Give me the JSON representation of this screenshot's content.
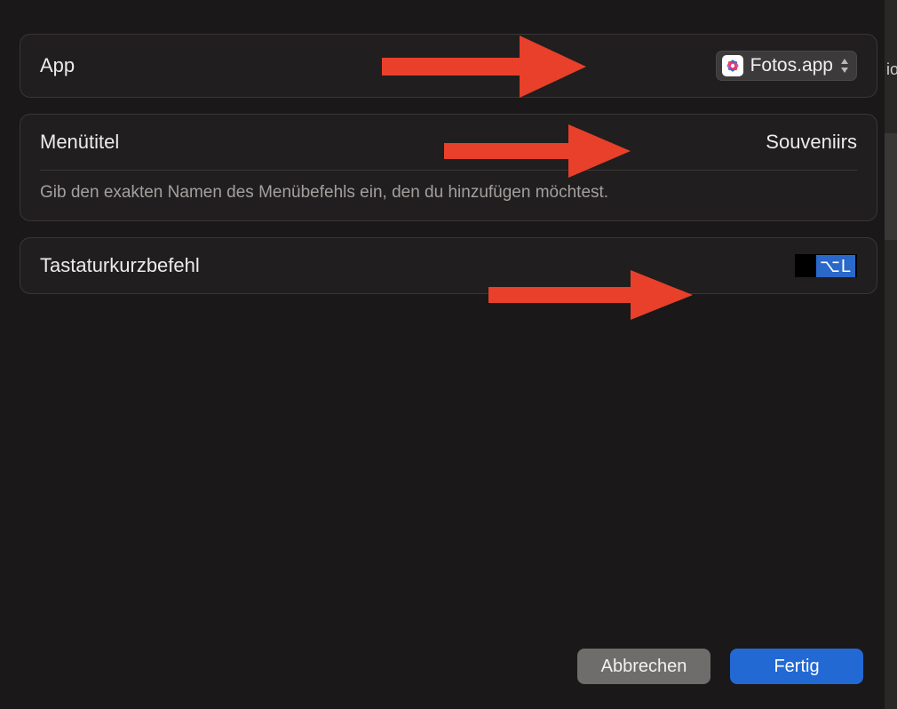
{
  "appRow": {
    "label": "App",
    "selectedAppName": "Fotos.app"
  },
  "menuTitleRow": {
    "label": "Menütitel",
    "value": "Souveniirs",
    "helperText": "Gib den exakten Namen des Menübefehls ein, den du hinzufügen möchtest."
  },
  "shortcutRow": {
    "label": "Tastaturkurzbefehl",
    "value": "⌥L"
  },
  "footer": {
    "cancel": "Abbrechen",
    "done": "Fertig"
  },
  "bgEdge": {
    "partialText": "io"
  }
}
